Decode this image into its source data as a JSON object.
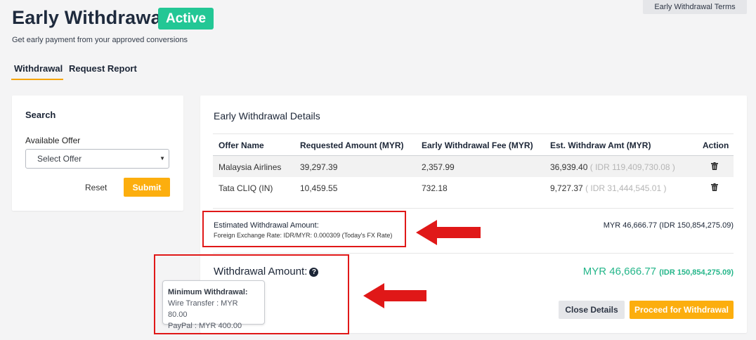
{
  "header": {
    "title": "Early Withdrawal",
    "status": "Active",
    "subtitle": "Get early payment from your approved conversions",
    "terms_label": "Early Withdrawal Terms"
  },
  "tabs": [
    {
      "label": "Withdrawal",
      "active": true
    },
    {
      "label": "Request Report",
      "active": false
    }
  ],
  "search": {
    "title": "Search",
    "offer_label": "Available Offer",
    "offer_selected": "Select Offer",
    "reset_label": "Reset",
    "submit_label": "Submit"
  },
  "details": {
    "title": "Early Withdrawal Details",
    "columns": [
      "Offer Name",
      "Requested Amount (MYR)",
      "Early Withdrawal Fee (MYR)",
      "Est. Withdraw Amt (MYR)",
      "Action"
    ],
    "rows": [
      {
        "offer": "Malaysia Airlines",
        "requested": "39,297.39",
        "fee": "2,357.99",
        "est": "36,939.40",
        "est_idr": "( IDR 119,409,730.08 )",
        "action_icon": "trash-icon"
      },
      {
        "offer": "Tata CLIQ (IN)",
        "requested": "10,459.55",
        "fee": "732.18",
        "est": "9,727.37",
        "est_idr": "( IDR 31,444,545.01 )",
        "action_icon": "trash-icon"
      }
    ],
    "estimated_label": "Estimated Withdrawal Amount:",
    "fx_rate": "Foreign Exchange Rate: IDR/MYR: 0.000309 (Today's FX Rate)",
    "estimated_value": "MYR 46,666.77 (IDR 150,854,275.09)",
    "withdrawal_label": "Withdrawal Amount:",
    "withdrawal_value": "MYR 46,666.77",
    "withdrawal_value_idr": "(IDR 150,854,275.09)",
    "close_label": "Close Details",
    "proceed_label": "Proceed for Withdrawal"
  },
  "tooltip": {
    "title": "Minimum Withdrawal:",
    "wire": "Wire Transfer : MYR 80.00",
    "paypal": "PayPal : MYR 400.00"
  },
  "colors": {
    "accent": "#fcae0e",
    "active_badge": "#23c795",
    "success_value": "#25b68a",
    "annotation": "#e01818"
  }
}
